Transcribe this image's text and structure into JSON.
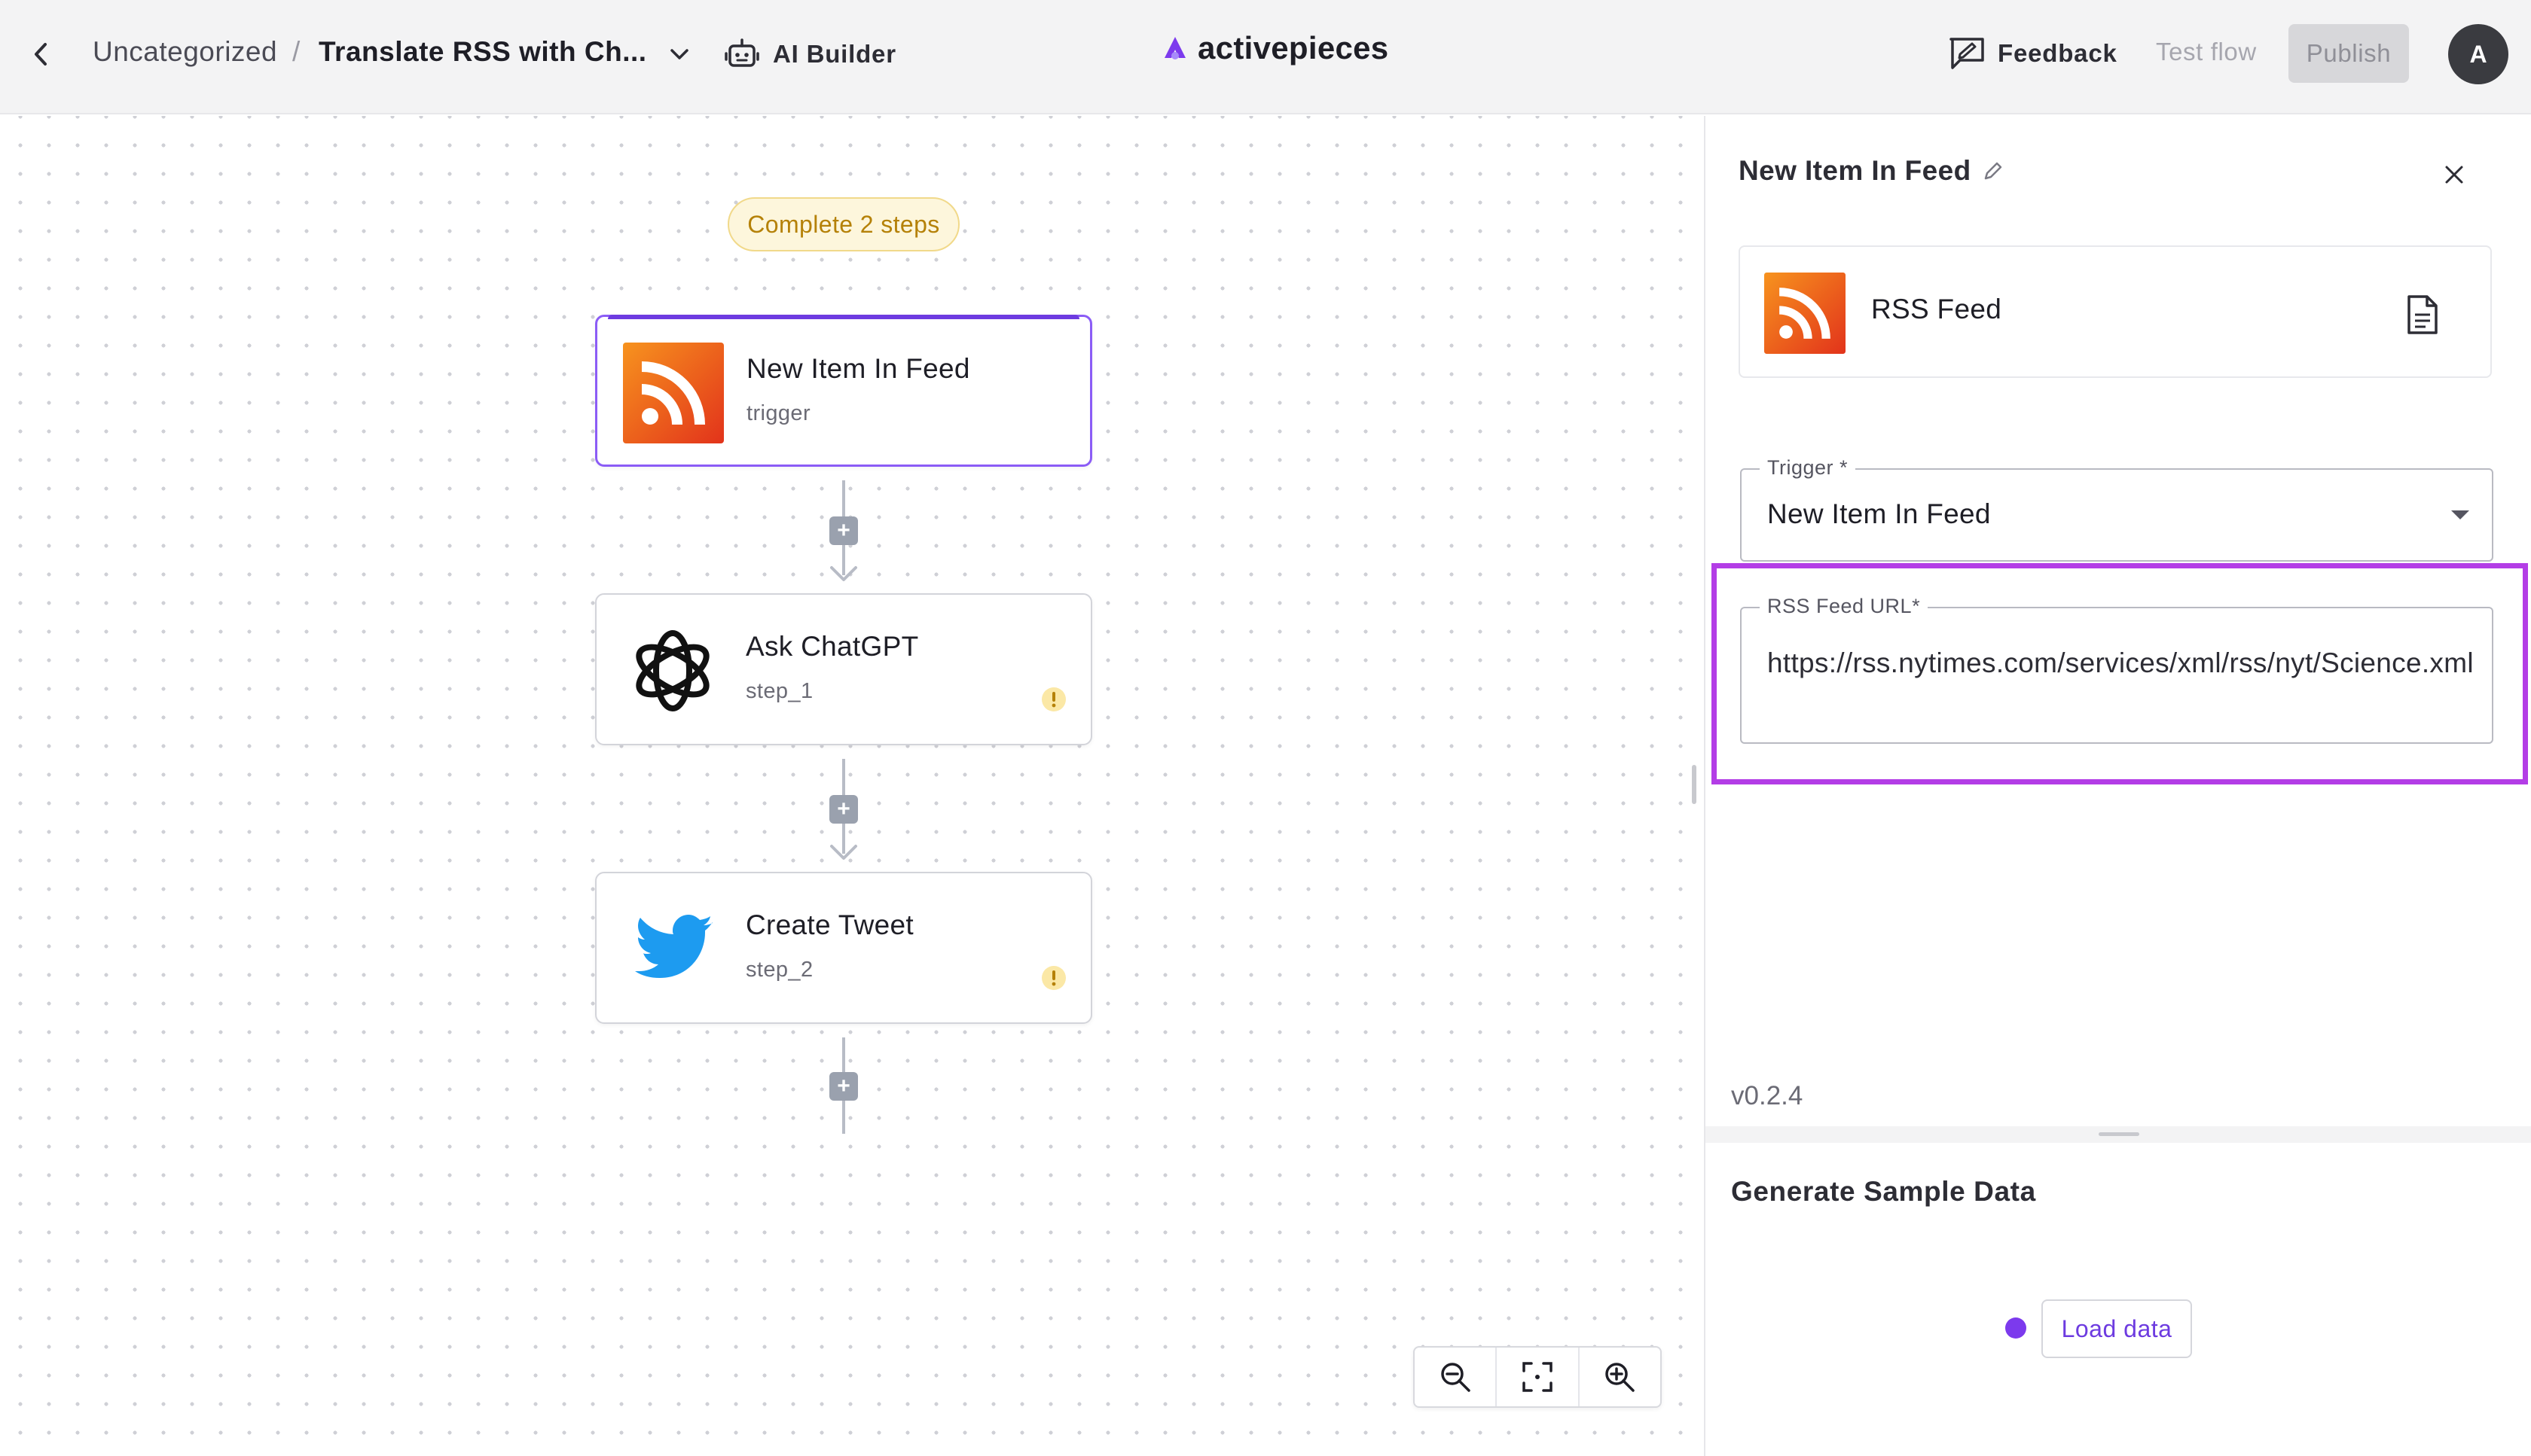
{
  "header": {
    "breadcrumb_folder": "Uncategorized",
    "breadcrumb_separator": "/",
    "flow_title": "Translate RSS with Ch...",
    "ai_builder_label": "AI Builder",
    "logo_text": "activepieces",
    "feedback_label": "Feedback",
    "test_flow_label": "Test flow",
    "publish_label": "Publish",
    "avatar_initial": "A"
  },
  "canvas": {
    "steps_badge": "Complete 2 steps",
    "nodes": [
      {
        "title": "New Item In Feed",
        "subtitle": "trigger",
        "icon": "rss-icon",
        "selected": true,
        "warning": false
      },
      {
        "title": "Ask ChatGPT",
        "subtitle": "step_1",
        "icon": "openai-icon",
        "selected": false,
        "warning": true
      },
      {
        "title": "Create Tweet",
        "subtitle": "step_2",
        "icon": "twitter-icon",
        "selected": false,
        "warning": true
      }
    ],
    "zoom_controls": [
      "zoom-out-icon",
      "fit-view-icon",
      "zoom-in-icon"
    ]
  },
  "panel": {
    "title": "New Item In Feed",
    "piece_name": "RSS Feed",
    "trigger_label": "Trigger *",
    "trigger_value": "New Item In Feed",
    "url_label": "RSS Feed URL*",
    "url_value": "https://rss.nytimes.com/services/xml/rss/nyt/Science.xml",
    "version": "v0.2.4",
    "sample_title": "Generate Sample Data",
    "load_data_label": "Load data"
  },
  "colors": {
    "accent": "#6d3be0",
    "highlight": "#b33de6",
    "rss_orange": "#f26522",
    "twitter_blue": "#1d9bf0",
    "warning": "#f5c542"
  }
}
